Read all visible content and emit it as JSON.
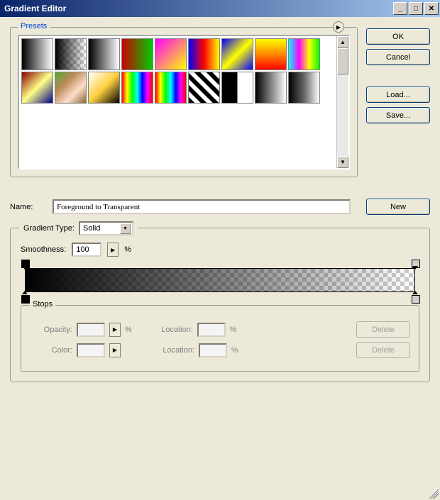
{
  "window": {
    "title": "Gradient Editor"
  },
  "buttons": {
    "ok": "OK",
    "cancel": "Cancel",
    "load": "Load...",
    "save": "Save...",
    "new": "New",
    "delete": "Delete"
  },
  "presets": {
    "label": "Presets"
  },
  "name": {
    "label": "Name:",
    "value": "Foreground to Transparent"
  },
  "gradient_type": {
    "label": "Gradient Type:",
    "value": "Solid"
  },
  "smoothness": {
    "label": "Smoothness:",
    "value": "100",
    "unit": "%"
  },
  "stops": {
    "label": "Stops",
    "opacity_label": "Opacity:",
    "opacity_value": "",
    "opacity_unit": "%",
    "color_label": "Color:",
    "location_label": "Location:",
    "location_value": "",
    "location_unit": "%"
  }
}
